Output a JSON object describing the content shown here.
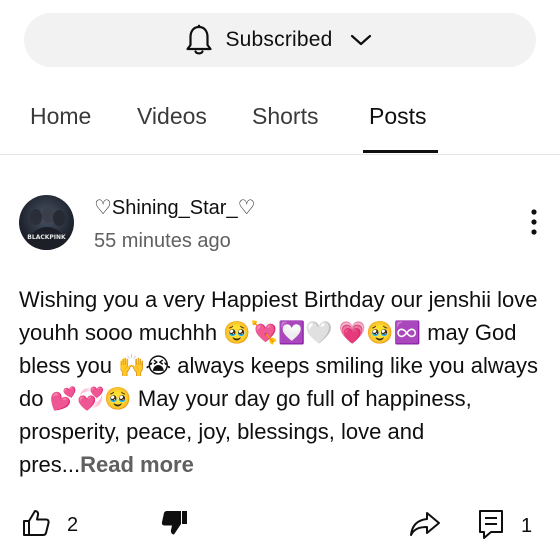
{
  "subscribe": {
    "label": "Subscribed",
    "bell_icon": "bell-icon",
    "chevron_icon": "chevron-down-icon"
  },
  "tabs": [
    {
      "label": "Home",
      "active": false
    },
    {
      "label": "Videos",
      "active": false
    },
    {
      "label": "Shorts",
      "active": false
    },
    {
      "label": "Posts",
      "active": true
    }
  ],
  "post": {
    "author": "♡Shining_Star_♡",
    "time": "55 minutes ago",
    "avatar_text": "BLACKPINK",
    "text": "Wishing you a very Happiest Birthday our jenshii love youhh sooo muchhh 🥹💘💟🤍 💗🥹♾️ may God bless you 🙌😭 always keeps smiling like you always do 💕💞🥹 May your day go full of happiness, prosperity, peace, joy, blessings, love and pres...",
    "read_more": "Read more",
    "likes": "2",
    "comments": "1"
  },
  "colors": {
    "pill_bg": "#f2f2f2",
    "text": "#0f0f0f",
    "muted": "#606060"
  }
}
